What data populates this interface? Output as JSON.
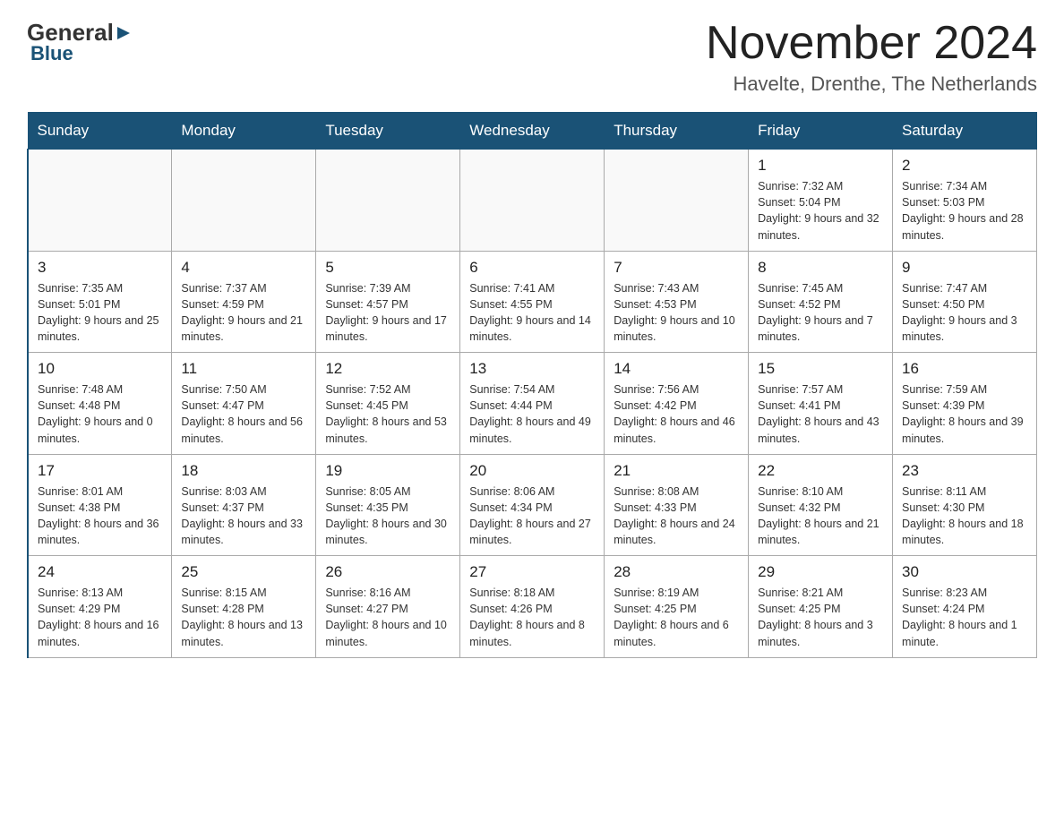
{
  "header": {
    "logo_general": "General",
    "logo_blue": "Blue",
    "month_title": "November 2024",
    "location": "Havelte, Drenthe, The Netherlands"
  },
  "weekdays": [
    "Sunday",
    "Monday",
    "Tuesday",
    "Wednesday",
    "Thursday",
    "Friday",
    "Saturday"
  ],
  "weeks": [
    [
      {
        "day": "",
        "sunrise": "",
        "sunset": "",
        "daylight": ""
      },
      {
        "day": "",
        "sunrise": "",
        "sunset": "",
        "daylight": ""
      },
      {
        "day": "",
        "sunrise": "",
        "sunset": "",
        "daylight": ""
      },
      {
        "day": "",
        "sunrise": "",
        "sunset": "",
        "daylight": ""
      },
      {
        "day": "",
        "sunrise": "",
        "sunset": "",
        "daylight": ""
      },
      {
        "day": "1",
        "sunrise": "Sunrise: 7:32 AM",
        "sunset": "Sunset: 5:04 PM",
        "daylight": "Daylight: 9 hours and 32 minutes."
      },
      {
        "day": "2",
        "sunrise": "Sunrise: 7:34 AM",
        "sunset": "Sunset: 5:03 PM",
        "daylight": "Daylight: 9 hours and 28 minutes."
      }
    ],
    [
      {
        "day": "3",
        "sunrise": "Sunrise: 7:35 AM",
        "sunset": "Sunset: 5:01 PM",
        "daylight": "Daylight: 9 hours and 25 minutes."
      },
      {
        "day": "4",
        "sunrise": "Sunrise: 7:37 AM",
        "sunset": "Sunset: 4:59 PM",
        "daylight": "Daylight: 9 hours and 21 minutes."
      },
      {
        "day": "5",
        "sunrise": "Sunrise: 7:39 AM",
        "sunset": "Sunset: 4:57 PM",
        "daylight": "Daylight: 9 hours and 17 minutes."
      },
      {
        "day": "6",
        "sunrise": "Sunrise: 7:41 AM",
        "sunset": "Sunset: 4:55 PM",
        "daylight": "Daylight: 9 hours and 14 minutes."
      },
      {
        "day": "7",
        "sunrise": "Sunrise: 7:43 AM",
        "sunset": "Sunset: 4:53 PM",
        "daylight": "Daylight: 9 hours and 10 minutes."
      },
      {
        "day": "8",
        "sunrise": "Sunrise: 7:45 AM",
        "sunset": "Sunset: 4:52 PM",
        "daylight": "Daylight: 9 hours and 7 minutes."
      },
      {
        "day": "9",
        "sunrise": "Sunrise: 7:47 AM",
        "sunset": "Sunset: 4:50 PM",
        "daylight": "Daylight: 9 hours and 3 minutes."
      }
    ],
    [
      {
        "day": "10",
        "sunrise": "Sunrise: 7:48 AM",
        "sunset": "Sunset: 4:48 PM",
        "daylight": "Daylight: 9 hours and 0 minutes."
      },
      {
        "day": "11",
        "sunrise": "Sunrise: 7:50 AM",
        "sunset": "Sunset: 4:47 PM",
        "daylight": "Daylight: 8 hours and 56 minutes."
      },
      {
        "day": "12",
        "sunrise": "Sunrise: 7:52 AM",
        "sunset": "Sunset: 4:45 PM",
        "daylight": "Daylight: 8 hours and 53 minutes."
      },
      {
        "day": "13",
        "sunrise": "Sunrise: 7:54 AM",
        "sunset": "Sunset: 4:44 PM",
        "daylight": "Daylight: 8 hours and 49 minutes."
      },
      {
        "day": "14",
        "sunrise": "Sunrise: 7:56 AM",
        "sunset": "Sunset: 4:42 PM",
        "daylight": "Daylight: 8 hours and 46 minutes."
      },
      {
        "day": "15",
        "sunrise": "Sunrise: 7:57 AM",
        "sunset": "Sunset: 4:41 PM",
        "daylight": "Daylight: 8 hours and 43 minutes."
      },
      {
        "day": "16",
        "sunrise": "Sunrise: 7:59 AM",
        "sunset": "Sunset: 4:39 PM",
        "daylight": "Daylight: 8 hours and 39 minutes."
      }
    ],
    [
      {
        "day": "17",
        "sunrise": "Sunrise: 8:01 AM",
        "sunset": "Sunset: 4:38 PM",
        "daylight": "Daylight: 8 hours and 36 minutes."
      },
      {
        "day": "18",
        "sunrise": "Sunrise: 8:03 AM",
        "sunset": "Sunset: 4:37 PM",
        "daylight": "Daylight: 8 hours and 33 minutes."
      },
      {
        "day": "19",
        "sunrise": "Sunrise: 8:05 AM",
        "sunset": "Sunset: 4:35 PM",
        "daylight": "Daylight: 8 hours and 30 minutes."
      },
      {
        "day": "20",
        "sunrise": "Sunrise: 8:06 AM",
        "sunset": "Sunset: 4:34 PM",
        "daylight": "Daylight: 8 hours and 27 minutes."
      },
      {
        "day": "21",
        "sunrise": "Sunrise: 8:08 AM",
        "sunset": "Sunset: 4:33 PM",
        "daylight": "Daylight: 8 hours and 24 minutes."
      },
      {
        "day": "22",
        "sunrise": "Sunrise: 8:10 AM",
        "sunset": "Sunset: 4:32 PM",
        "daylight": "Daylight: 8 hours and 21 minutes."
      },
      {
        "day": "23",
        "sunrise": "Sunrise: 8:11 AM",
        "sunset": "Sunset: 4:30 PM",
        "daylight": "Daylight: 8 hours and 18 minutes."
      }
    ],
    [
      {
        "day": "24",
        "sunrise": "Sunrise: 8:13 AM",
        "sunset": "Sunset: 4:29 PM",
        "daylight": "Daylight: 8 hours and 16 minutes."
      },
      {
        "day": "25",
        "sunrise": "Sunrise: 8:15 AM",
        "sunset": "Sunset: 4:28 PM",
        "daylight": "Daylight: 8 hours and 13 minutes."
      },
      {
        "day": "26",
        "sunrise": "Sunrise: 8:16 AM",
        "sunset": "Sunset: 4:27 PM",
        "daylight": "Daylight: 8 hours and 10 minutes."
      },
      {
        "day": "27",
        "sunrise": "Sunrise: 8:18 AM",
        "sunset": "Sunset: 4:26 PM",
        "daylight": "Daylight: 8 hours and 8 minutes."
      },
      {
        "day": "28",
        "sunrise": "Sunrise: 8:19 AM",
        "sunset": "Sunset: 4:25 PM",
        "daylight": "Daylight: 8 hours and 6 minutes."
      },
      {
        "day": "29",
        "sunrise": "Sunrise: 8:21 AM",
        "sunset": "Sunset: 4:25 PM",
        "daylight": "Daylight: 8 hours and 3 minutes."
      },
      {
        "day": "30",
        "sunrise": "Sunrise: 8:23 AM",
        "sunset": "Sunset: 4:24 PM",
        "daylight": "Daylight: 8 hours and 1 minute."
      }
    ]
  ]
}
